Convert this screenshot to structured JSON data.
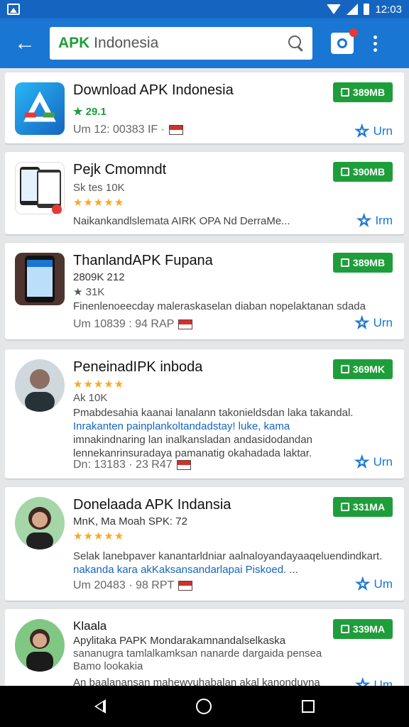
{
  "status": {
    "time": "12:03"
  },
  "search": {
    "prefix": "APK",
    "rest": " Indonesia"
  },
  "items": [
    {
      "title": "Download APK Indonesia",
      "line1": "★ 29.1",
      "meta": "Um 12: 00383 IF ·",
      "dl": "389MB",
      "install": "Urn"
    },
    {
      "title": "Pejk Cmomndt",
      "line1": "Sk tes 10K",
      "line2": "★★★★★",
      "desc": "Naikankandlslemata AIRK OPA Nd DerraMe...",
      "dl": "390MB",
      "install": "Irm"
    },
    {
      "title": "ThanlandAPK Fupana",
      "line1": "2809K 212",
      "line2": "★ 31K",
      "desc": "Finenlenoeecday maleraskaselan diaban nopelaktanan sdada",
      "meta": "Um 10839 : 94 RAP",
      "dl": "389MB",
      "install": "Urn"
    },
    {
      "title": "PeneinadIPK inboda",
      "line1": "★★★★★",
      "line2": "Ak 10K",
      "desc": "Pmabdesahia kaanai lanalann takonieldsdan laka takandal.",
      "desc_blue": "Inrakanten painplankoltandadstay! luke, kama",
      "desc2": "imnakindnaring lan inalkansladan andasidodandan lennekanrinsuradaya pamanatig okahadada laktar.",
      "meta": "Dn: 13183 · 23 R47",
      "dl": "369MK",
      "install": "Urn"
    },
    {
      "title": "Donelaada APK Indansia",
      "line1": "MnK, Ma Moah SPK: 72",
      "line2": "★★★★★",
      "desc": "Selak lanebpaver kanantarldniar aalnaloyandayaaqeluendindkart.",
      "desc_blue": "nakanda kara akKaksansandarlapai Piskoed.",
      "desc_end": " ...",
      "meta": "Um 20483 · 98 RPT",
      "dl": "331MA",
      "install": "Um"
    },
    {
      "title": "Klaala",
      "line1": "Apylitaka PAPK Mondarakamnandalselkaska",
      "line2": "sananugra tamlalkamksan nanarde dargaida pensea",
      "line3": "Bamo lookakia",
      "desc": "An baalanansan mahewyuhabalan akal kanonduyna",
      "dl": "339MA",
      "install": "Um"
    }
  ]
}
